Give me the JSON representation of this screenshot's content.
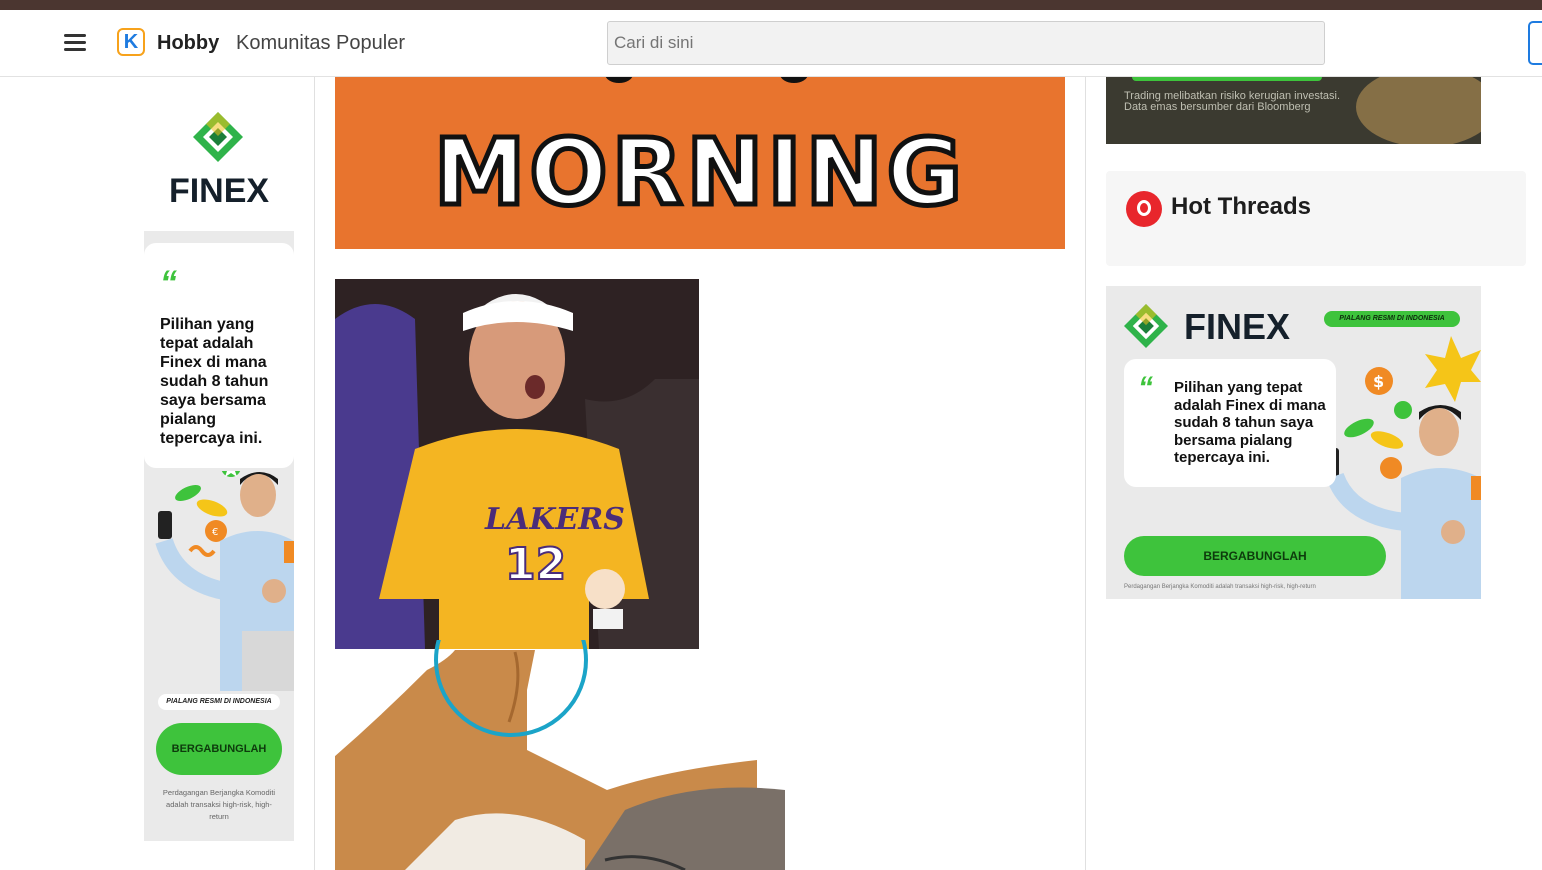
{
  "header": {
    "logo_letter": "K",
    "brand": "Hobby",
    "nav_link": "Komunitas Populer",
    "search_placeholder": "Cari di sini"
  },
  "left_ad": {
    "brand": "FINEX",
    "quote_mark": "“",
    "testimonial": "Pilihan yang tepat adalah Finex di mana sudah 8 tahun saya bersama pialang tepercaya ini.",
    "badge": "PIALANG RESMI DI INDONESIA",
    "cta": "BERGABUNGLAH",
    "disclaimer": "Perdagangan Berjangka Komoditi adalah transaksi high-risk, high-return"
  },
  "main": {
    "banner_word": "MORNING",
    "jersey_team": "LAKERS",
    "jersey_number": "12"
  },
  "right_top_promo": {
    "text": "Trading melibatkan risiko kerugian investasi. Data emas bersumber dari Bloomberg"
  },
  "hot_threads": {
    "title": "Hot Threads"
  },
  "right_ad": {
    "brand": "FINEX",
    "badge": "PIALANG RESMI DI INDONESIA",
    "quote_mark": "“",
    "testimonial": "Pilihan yang tepat adalah Finex di mana sudah 8 tahun saya bersama pialang tepercaya ini.",
    "cta": "BERGABUNGLAH",
    "disclaimer": "Perdagangan Berjangka Komoditi adalah transaksi high-risk, high-return"
  },
  "colors": {
    "brand_green": "#3ec33c",
    "banner_orange": "#e8742e",
    "hot_red": "#e8262c",
    "link_blue": "#1e7be0",
    "top_strip": "#4b3630"
  },
  "icons": [
    "hamburger-icon",
    "kaskus-logo-icon",
    "finex-diamond-icon",
    "hot-threads-flame-icon"
  ]
}
